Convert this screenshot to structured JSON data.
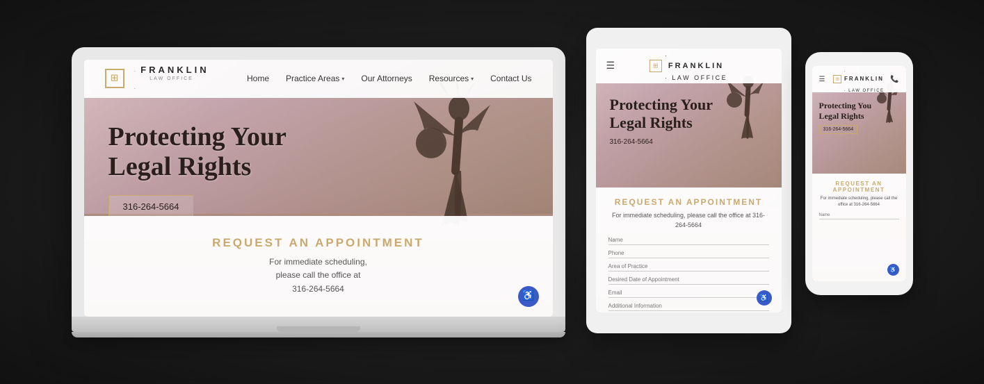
{
  "laptop": {
    "nav": {
      "logo_name": "Franklin",
      "logo_sub": "LAW OFFICE",
      "links": [
        "Home",
        "Practice Areas",
        "Our Attorneys",
        "Resources",
        "Contact Us"
      ]
    },
    "hero": {
      "title_line1": "Protecting Your",
      "title_line2": "Legal Rights",
      "phone": "316-264-5664"
    },
    "appointment": {
      "title": "REQUEST AN APPOINTMENT",
      "text_line1": "For immediate scheduling,",
      "text_line2": "please call the office at",
      "phone": "316-264-5664"
    }
  },
  "tablet": {
    "hero": {
      "title_line1": "Protecting Your",
      "title_line2": "Legal Rights",
      "phone": "316-264-5664"
    },
    "appointment": {
      "title": "REQUEST AN APPOINTMENT",
      "text_line1": "For immediate scheduling,",
      "text_line2": "please call the office at",
      "phone": "316-264-5664",
      "fields": [
        "Name",
        "Phone",
        "Area of Practice",
        "Desired Date of Appointment",
        "Email",
        "Additional Information"
      ]
    }
  },
  "phone": {
    "hero": {
      "title_line1": "Protecting You",
      "title_line2": "Legal Rights",
      "phone": "316-264-5664"
    },
    "appointment": {
      "title": "REQUEST AN APPOINTMENT",
      "text_line1": "For immediate scheduling,",
      "text_line2": "please call the office at",
      "phone": "316-264-5664",
      "fields": [
        "Name"
      ]
    }
  }
}
